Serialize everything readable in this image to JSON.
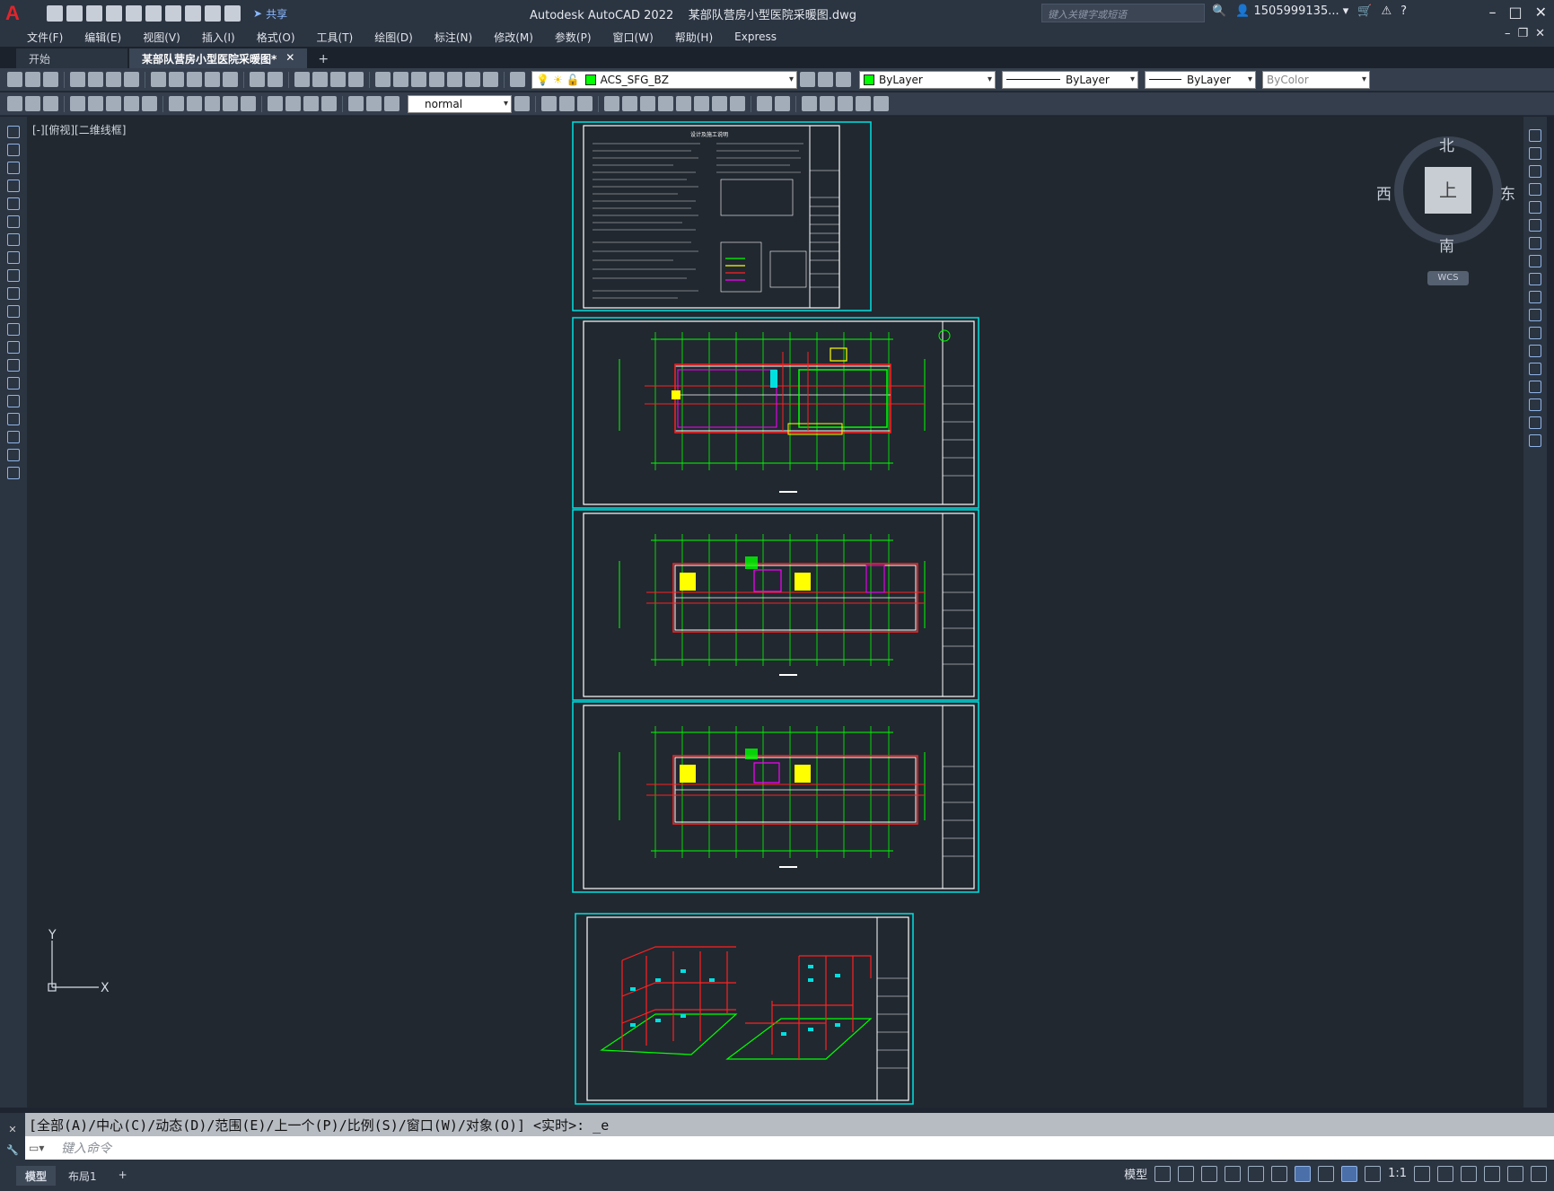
{
  "titlebar": {
    "app_title": "Autodesk AutoCAD 2022",
    "file_name": "某部队营房小型医院采暖图.dwg",
    "share_label": "共享",
    "search_placeholder": "键入关键字或短语",
    "user_label": "1505999135..."
  },
  "menu": [
    "文件(F)",
    "编辑(E)",
    "视图(V)",
    "插入(I)",
    "格式(O)",
    "工具(T)",
    "绘图(D)",
    "标注(N)",
    "修改(M)",
    "参数(P)",
    "窗口(W)",
    "帮助(H)",
    "Express"
  ],
  "tabs": {
    "start_label": "开始",
    "doc_label": "某部队营房小型医院采暖图*"
  },
  "toolbar": {
    "layer_name": "ACS_SFG_BZ",
    "layer_color": "#00ff00",
    "color_value": "ByLayer",
    "linetype_value": "ByLayer",
    "lineweight_value": "ByLayer",
    "plotstyle_value": "ByColor",
    "textstyle_value": "normal"
  },
  "viewport": {
    "label": "[-][俯视][二维线框]"
  },
  "viewcube": {
    "north": "北",
    "south": "南",
    "east": "东",
    "west": "西",
    "face": "上",
    "wcs": "WCS"
  },
  "ucs": {
    "x_label": "X",
    "y_label": "Y"
  },
  "sheets": {
    "notes_title": "设计及施工说明"
  },
  "command": {
    "history": "[全部(A)/中心(C)/动态(D)/范围(E)/上一个(P)/比例(S)/窗口(W)/对象(O)] <实时>: _e",
    "placeholder": "键入命令"
  },
  "status": {
    "model_tab": "模型",
    "layout_tab": "布局1",
    "model_label": "模型",
    "scale": "1:1"
  },
  "colors": {
    "accent": "#00e0e0",
    "pipe_red": "#ff2020",
    "grid_green": "#00ff00",
    "magenta": "#ff00ff",
    "cyan": "#00e0e0",
    "yellow": "#ffff00"
  }
}
